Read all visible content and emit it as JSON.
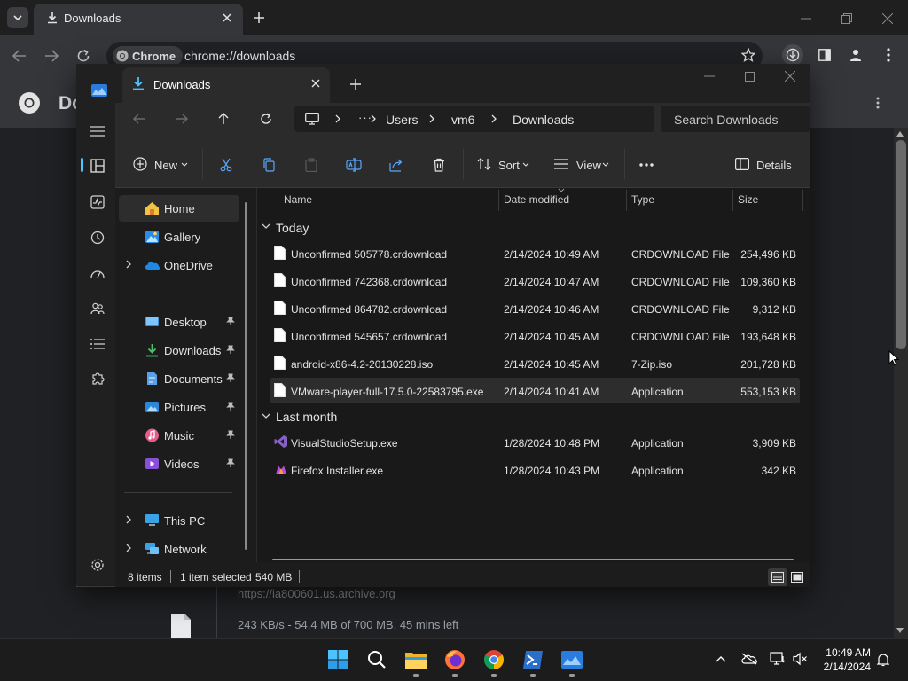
{
  "chrome": {
    "tab_title": "Downloads",
    "omnibox_chip": "Chrome",
    "url": "chrome://downloads",
    "page_header_partial": "Do",
    "bg_download_url": "https://ia800601.us.archive.org",
    "bg_download_progress": "243 KB/s - 54.4 MB of 700 MB, 45 mins left"
  },
  "explorer": {
    "tab_title": "Downloads",
    "breadcrumb": [
      "Users",
      "vm6",
      "Downloads"
    ],
    "search_placeholder": "Search Downloads",
    "commands": {
      "new_label": "New",
      "sort_label": "Sort",
      "view_label": "View",
      "details_label": "Details"
    },
    "nav": {
      "home": "Home",
      "gallery": "Gallery",
      "onedrive": "OneDrive",
      "desktop": "Desktop",
      "downloads": "Downloads",
      "documents": "Documents",
      "pictures": "Pictures",
      "music": "Music",
      "videos": "Videos",
      "this_pc": "This PC",
      "network": "Network"
    },
    "columns": {
      "name": "Name",
      "date": "Date modified",
      "type": "Type",
      "size": "Size"
    },
    "groups": {
      "today": {
        "label": "Today",
        "files": [
          {
            "name": "Unconfirmed 505778.crdownload",
            "date": "2/14/2024 10:49 AM",
            "type": "CRDOWNLOAD File",
            "size": "254,496 KB"
          },
          {
            "name": "Unconfirmed 742368.crdownload",
            "date": "2/14/2024 10:47 AM",
            "type": "CRDOWNLOAD File",
            "size": "109,360 KB"
          },
          {
            "name": "Unconfirmed 864782.crdownload",
            "date": "2/14/2024 10:46 AM",
            "type": "CRDOWNLOAD File",
            "size": "9,312 KB"
          },
          {
            "name": "Unconfirmed 545657.crdownload",
            "date": "2/14/2024 10:45 AM",
            "type": "CRDOWNLOAD File",
            "size": "193,648 KB"
          },
          {
            "name": "android-x86-4.2-20130228.iso",
            "date": "2/14/2024 10:45 AM",
            "type": "7-Zip.iso",
            "size": "201,728 KB"
          },
          {
            "name": "VMware-player-full-17.5.0-22583795.exe",
            "date": "2/14/2024 10:41 AM",
            "type": "Application",
            "size": "553,153 KB"
          }
        ]
      },
      "last_month": {
        "label": "Last month",
        "files": [
          {
            "name": "VisualStudioSetup.exe",
            "date": "1/28/2024 10:48 PM",
            "type": "Application",
            "size": "3,909 KB"
          },
          {
            "name": "Firefox Installer.exe",
            "date": "1/28/2024 10:43 PM",
            "type": "Application",
            "size": "342 KB"
          }
        ]
      }
    },
    "status": {
      "items": "8 items",
      "selected": "1 item selected",
      "size": "540 MB"
    }
  },
  "taskbar": {
    "time": "10:49 AM",
    "date": "2/14/2024"
  },
  "colors": {
    "accent": "#4cc2ff",
    "folder": "#f0c43f",
    "windows_blue": "#0078d4"
  }
}
